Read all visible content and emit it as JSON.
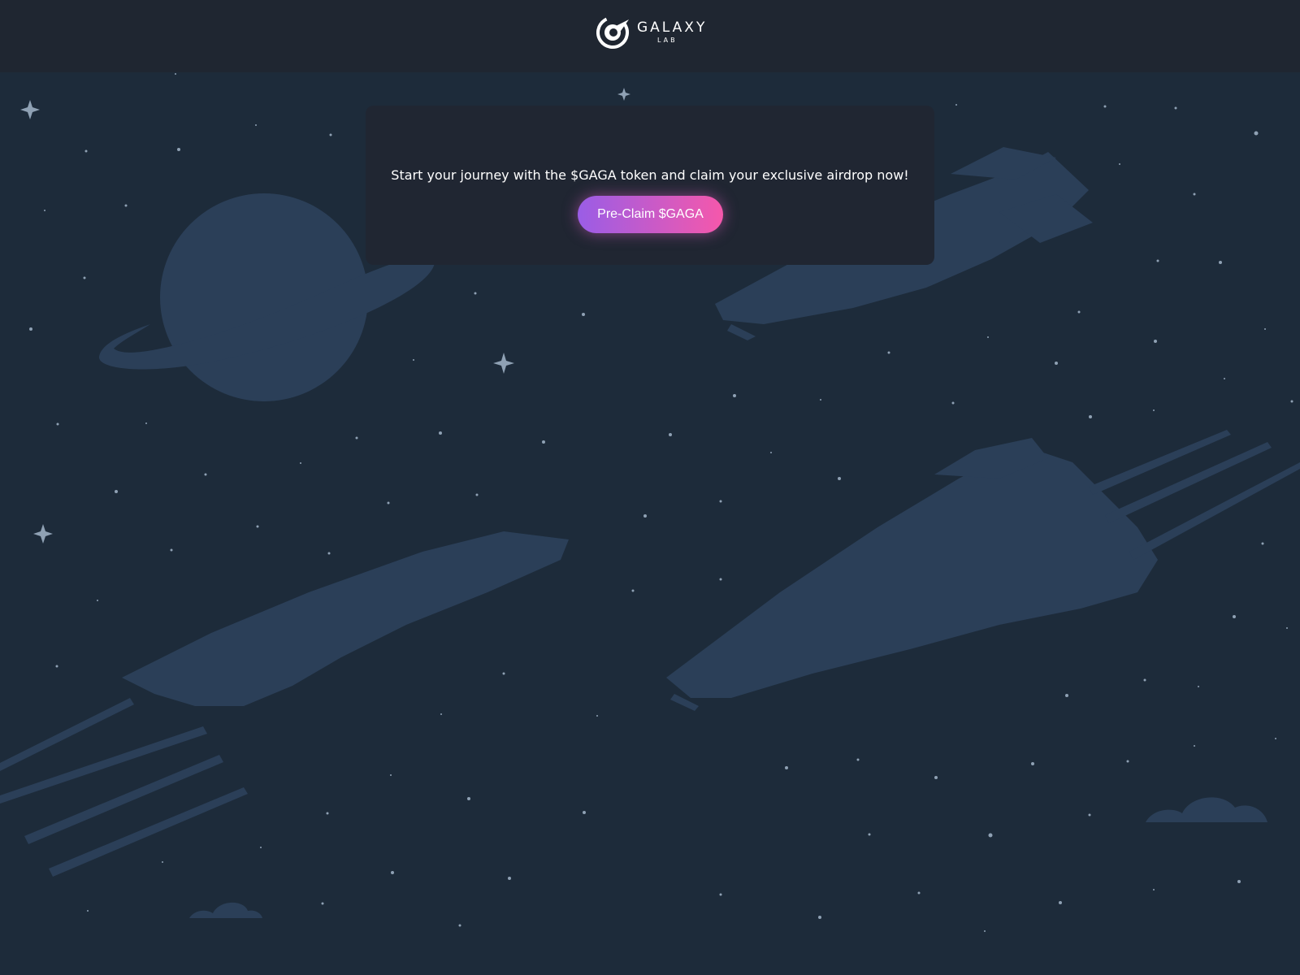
{
  "header": {
    "logo_title": "GALAXY",
    "logo_subtitle": "LAB",
    "logo_icon": "galaxy-lab-logo-icon"
  },
  "hero": {
    "message": "Start your journey with the $GAGA token and claim your exclusive airdrop now!",
    "cta_label": "Pre-Claim $GAGA"
  },
  "colors": {
    "background": "#1d2b3a",
    "header_background": "#1f2631",
    "card_background": "#202632",
    "illustration": "#2b3f58",
    "cta_gradient_start": "#9a5de6",
    "cta_gradient_end": "#f558ab"
  }
}
